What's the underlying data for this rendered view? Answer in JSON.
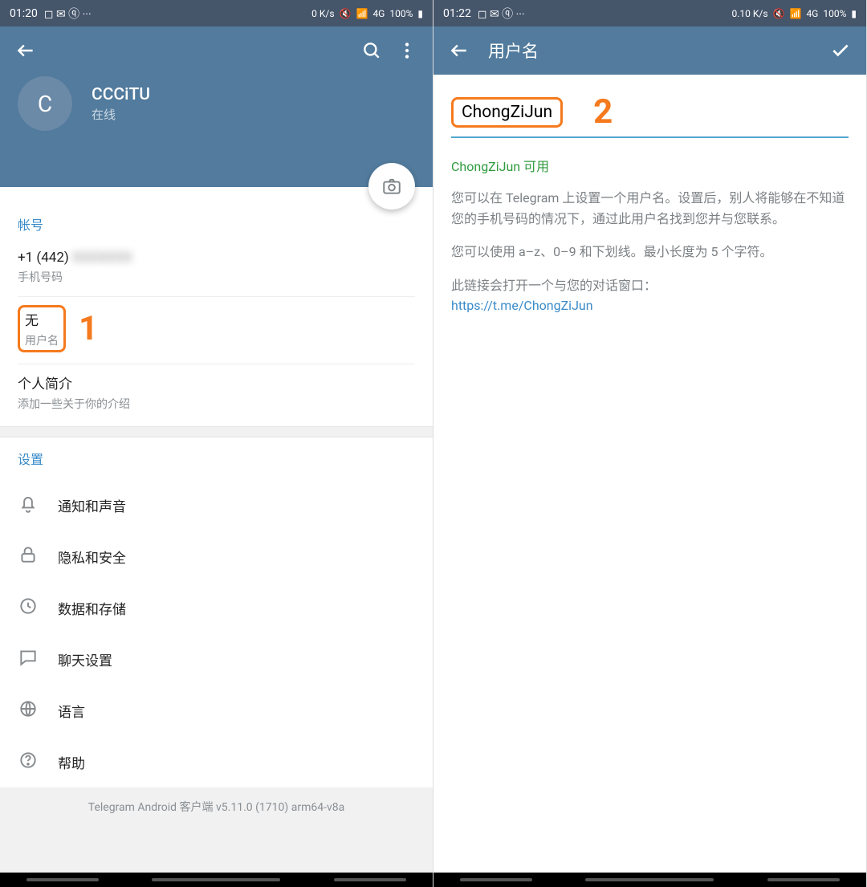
{
  "left": {
    "status": {
      "time": "01:20",
      "net": "0 K/s",
      "battery": "100%",
      "sig": "4G"
    },
    "profile": {
      "initial": "C",
      "name": "CCCiTU",
      "status": "在线"
    },
    "account_section": "帐号",
    "phone": {
      "value": "+1 (442) ",
      "redacted": "XXXXXXX",
      "label": "手机号码"
    },
    "username": {
      "value": "无",
      "label": "用户名"
    },
    "bio": {
      "value": "个人简介",
      "label": "添加一些关于你的介绍"
    },
    "settings_section": "设置",
    "settings": [
      "通知和声音",
      "隐私和安全",
      "数据和存储",
      "聊天设置",
      "语言",
      "帮助"
    ],
    "footer": "Telegram Android 客户端 v5.11.0 (1710) arm64-v8a",
    "annot": "1"
  },
  "right": {
    "status": {
      "time": "01:22",
      "net": "0.10 K/s",
      "battery": "100%",
      "sig": "4G"
    },
    "title": "用户名",
    "input": "ChongZiJun",
    "annot": "2",
    "available": "ChongZiJun 可用",
    "desc1": "您可以在 Telegram 上设置一个用户名。设置后，别人将能够在不知道您的手机号码的情况下，通过此用户名找到您并与您联系。",
    "desc2": "您可以使用 a–z、0–9 和下划线。最小长度为 5 个字符。",
    "desc3": "此链接会打开一个与您的对话窗口：",
    "link": "https://t.me/ChongZiJun"
  }
}
